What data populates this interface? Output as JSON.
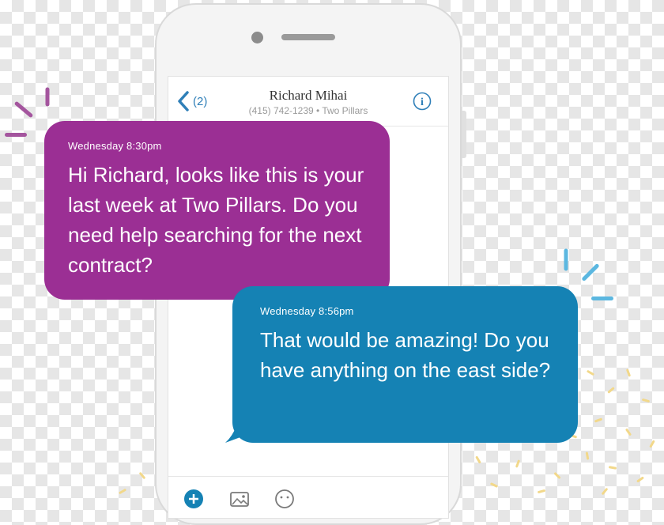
{
  "header": {
    "back_count": "(2)",
    "contact_name": "Richard Mihai",
    "contact_subtitle": "(415) 742-1239 • Two Pillars"
  },
  "messages": [
    {
      "time": "Wednesday 8:30pm",
      "text": "Hi Richard, looks like this is your last week at Two Pillars. Do you need help searching for the next contract?",
      "color": "#9b2f94"
    },
    {
      "time": "Wednesday 8:56pm",
      "text": "That would be amazing! Do you have anything on the east side?",
      "color": "#1582b4"
    }
  ],
  "icons": {
    "back": "chevron-left-icon",
    "info": "info-icon",
    "add": "plus-icon",
    "photo": "image-icon",
    "emoji": "emoji-icon"
  },
  "colors": {
    "accent_blue": "#2f7fb8",
    "purple_bubble": "#9b2f94",
    "blue_bubble": "#1582b4"
  }
}
